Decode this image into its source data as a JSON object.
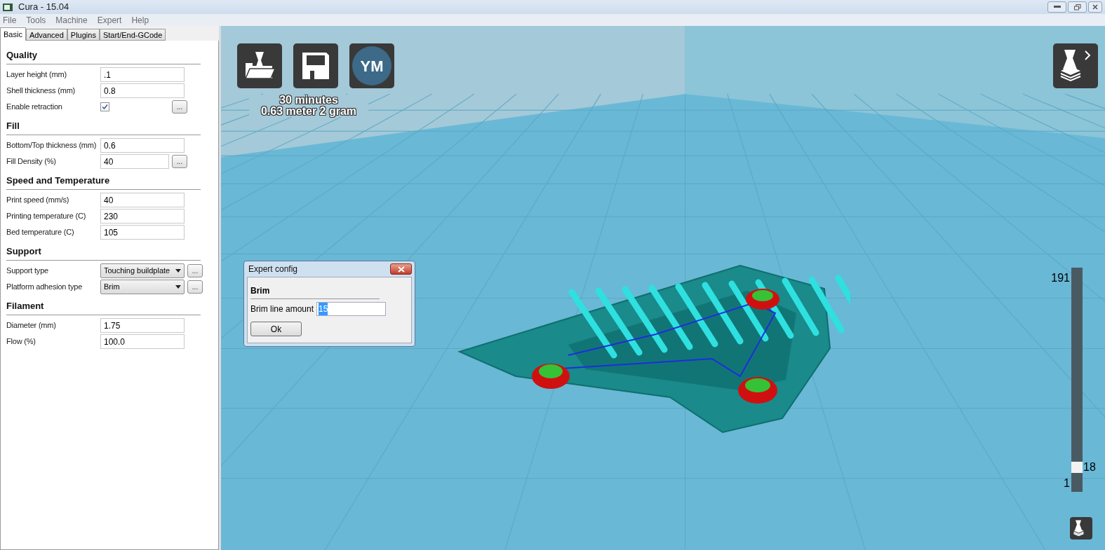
{
  "window": {
    "title": "Cura - 15.04"
  },
  "menu": [
    "File",
    "Tools",
    "Machine",
    "Expert",
    "Help"
  ],
  "tabs": [
    {
      "label": "Basic",
      "selected": true
    },
    {
      "label": "Advanced",
      "selected": false
    },
    {
      "label": "Plugins",
      "selected": false
    },
    {
      "label": "Start/End-GCode",
      "selected": false
    }
  ],
  "sections": [
    {
      "title": "Quality",
      "fields": [
        {
          "kind": "text",
          "label": "Layer height (mm)",
          "value": ".1",
          "more_button": false
        },
        {
          "kind": "text",
          "label": "Shell thickness (mm)",
          "value": "0.8",
          "more_button": false
        },
        {
          "kind": "checkbox",
          "label": "Enable retraction",
          "checked": true,
          "more_button": true,
          "more_label": "..."
        }
      ]
    },
    {
      "title": "Fill",
      "fields": [
        {
          "kind": "text",
          "label": "Bottom/Top thickness (mm)",
          "value": "0.6",
          "more_button": false
        },
        {
          "kind": "text",
          "label": "Fill Density (%)",
          "value": "40",
          "more_button": true,
          "more_label": "..."
        }
      ]
    },
    {
      "title": "Speed and Temperature",
      "fields": [
        {
          "kind": "text",
          "label": "Print speed (mm/s)",
          "value": "40",
          "more_button": false
        },
        {
          "kind": "text",
          "label": "Printing temperature (C)",
          "value": "230",
          "more_button": false
        },
        {
          "kind": "text",
          "label": "Bed temperature (C)",
          "value": "105",
          "more_button": false
        }
      ]
    },
    {
      "title": "Support",
      "fields": [
        {
          "kind": "select",
          "label": "Support type",
          "value": "Touching buildplate",
          "more_button": true,
          "more_label": "..."
        },
        {
          "kind": "select",
          "label": "Platform adhesion type",
          "value": "Brim",
          "more_button": true,
          "more_label": "..."
        }
      ]
    },
    {
      "title": "Filament",
      "fields": [
        {
          "kind": "text",
          "label": "Diameter (mm)",
          "value": "1.75",
          "more_button": false
        },
        {
          "kind": "text",
          "label": "Flow (%)",
          "value": "100.0",
          "more_button": false
        }
      ]
    }
  ],
  "viewport": {
    "avatar_initials": "YM",
    "print_time": "30 minutes",
    "print_material": "0.63 meter 2 gram",
    "layer_slider": {
      "max": "191",
      "min": "1",
      "current": "18",
      "level": 0.09
    }
  },
  "dialog": {
    "title": "Expert config",
    "section": "Brim",
    "field_label": "Brim line amount",
    "field_value": "15",
    "value_selected": true,
    "button": "Ok"
  }
}
